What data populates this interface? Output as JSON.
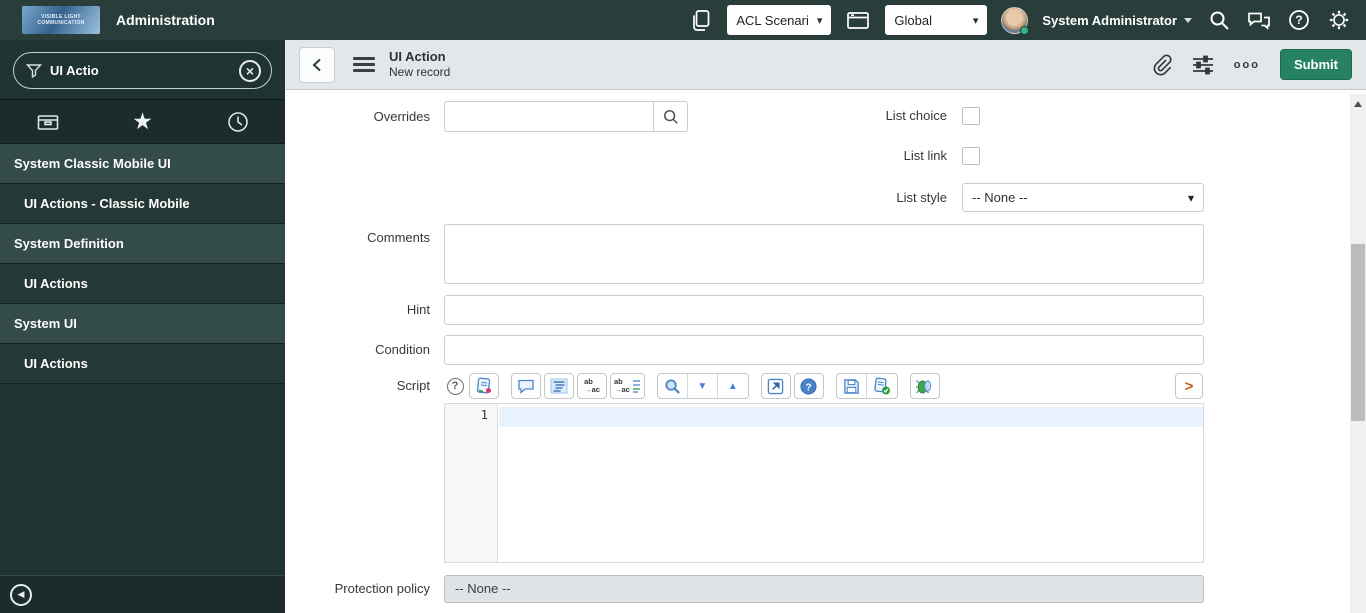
{
  "header": {
    "logo_text": "VISIBLE LIGHT COMMUNICATION",
    "app_title": "Administration",
    "update_set_value": "ACL Scenari",
    "scope_value": "Global",
    "user_name": "System Administrator"
  },
  "sidebar": {
    "filter_value": "UI Actio",
    "nav": [
      {
        "label": "System Classic Mobile UI",
        "type": "header"
      },
      {
        "label": "UI Actions - Classic Mobile",
        "type": "item"
      },
      {
        "label": "System Definition",
        "type": "header"
      },
      {
        "label": "UI Actions",
        "type": "item"
      },
      {
        "label": "System UI",
        "type": "header"
      },
      {
        "label": "UI Actions",
        "type": "item"
      }
    ]
  },
  "form_header": {
    "title": "UI Action",
    "subtitle": "New record",
    "more_label": "ooo",
    "submit_label": "Submit"
  },
  "form": {
    "overrides_label": "Overrides",
    "overrides_value": "",
    "list_choice_label": "List choice",
    "list_link_label": "List link",
    "list_style_label": "List style",
    "list_style_value": "-- None --",
    "comments_label": "Comments",
    "comments_value": "",
    "hint_label": "Hint",
    "hint_value": "",
    "condition_label": "Condition",
    "condition_value": "",
    "script_label": "Script",
    "script_line_number": "1",
    "script_value": "",
    "protection_label": "Protection policy",
    "protection_value": "-- None --"
  },
  "icons": {
    "star_glyph": "★",
    "clear_glyph": "×",
    "collapse_glyph": "◀",
    "select_caret": "▾",
    "help_glyph": "?",
    "find_next_glyph": "▼",
    "find_prev_glyph": "▲",
    "expand_glyph": ">",
    "replace_top": "ab",
    "replace_bottom": "ac",
    "replace_arrow": "→"
  },
  "colors": {
    "banner_bg": "#293e3b",
    "submit_green": "#278264",
    "toolbar_blue": "#4a84c8",
    "active_line": "#e8f2fc"
  }
}
